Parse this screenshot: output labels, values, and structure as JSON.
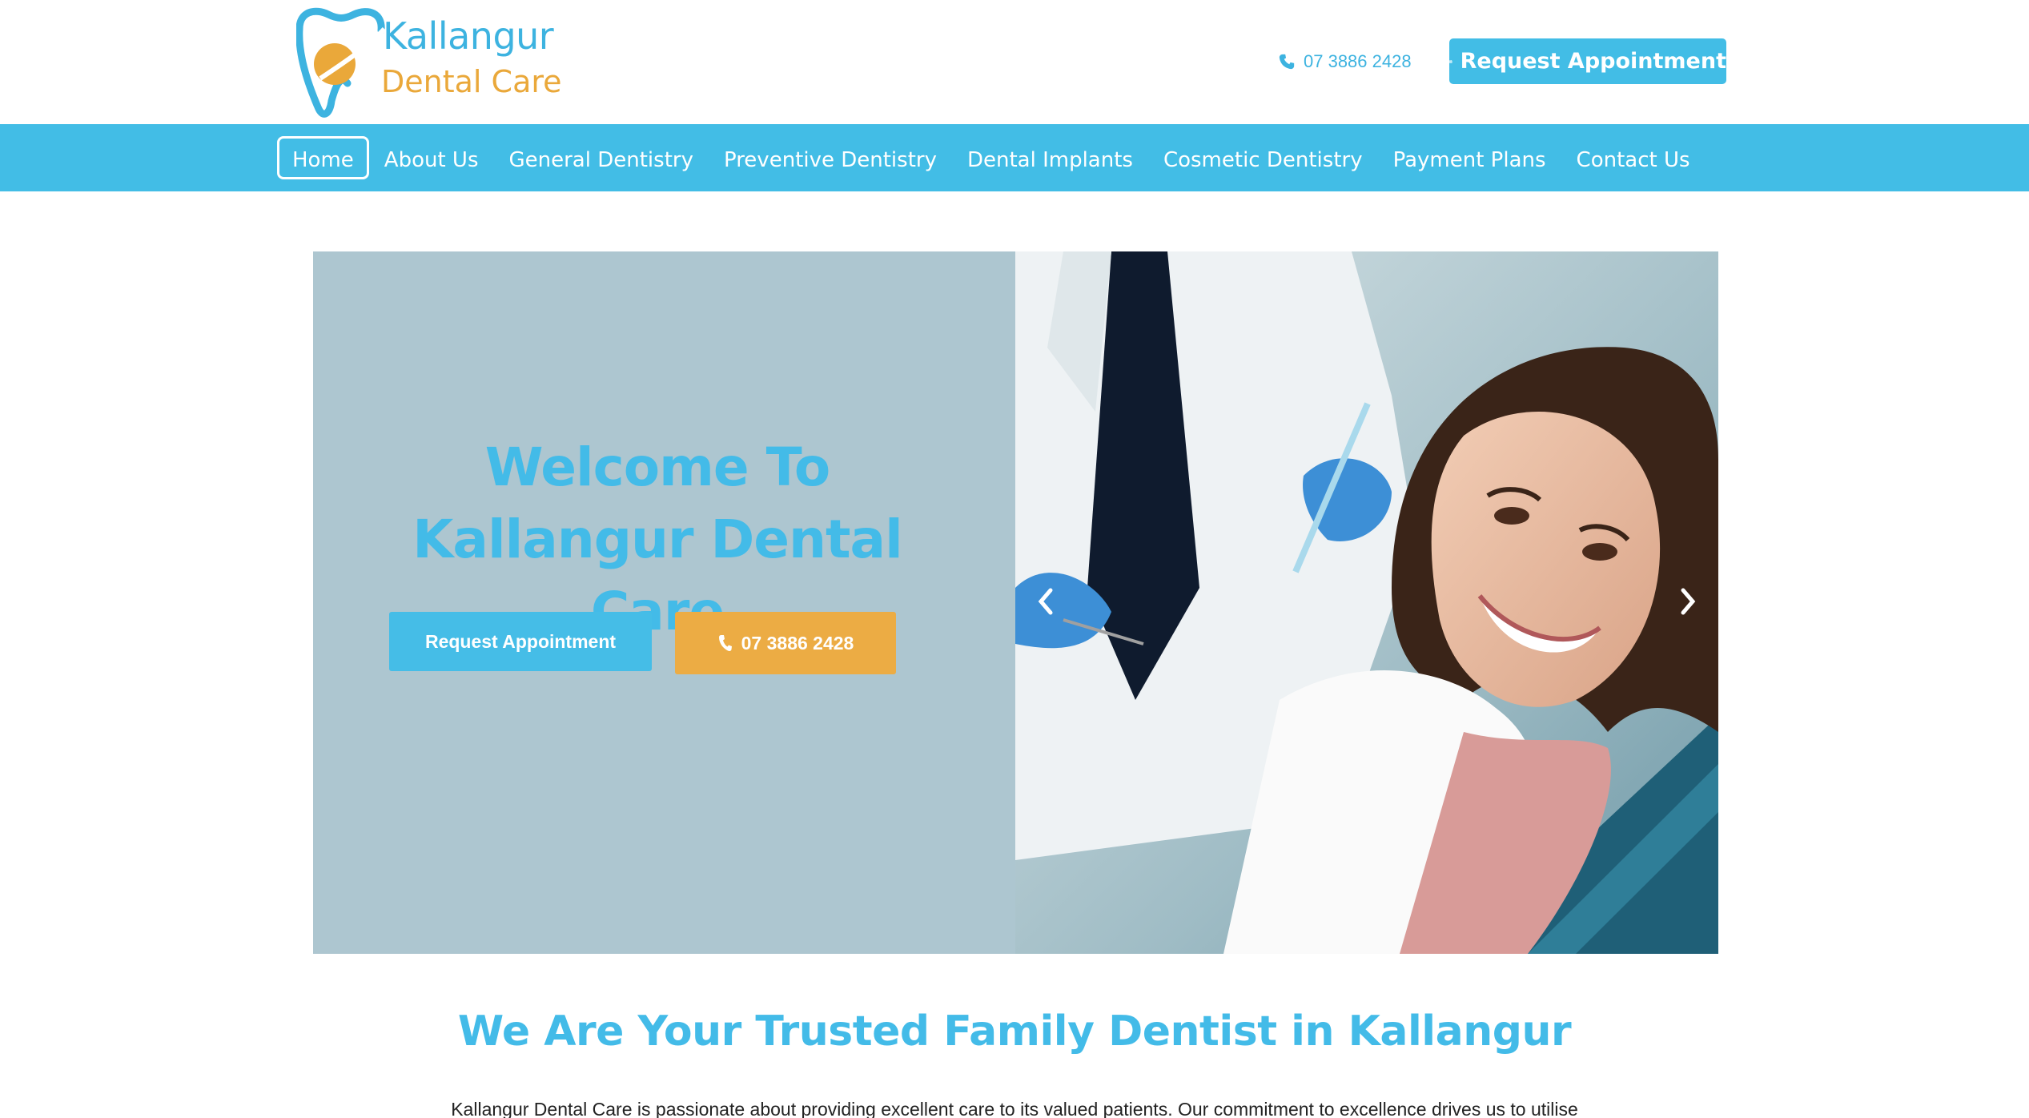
{
  "header": {
    "logo_line_1": "Kallangur",
    "logo_line_2": "Dental Care",
    "phone": "07 3886 2428",
    "cta_label": "Request Appointment"
  },
  "nav": {
    "items": [
      {
        "label": "Home",
        "active": true
      },
      {
        "label": "About Us"
      },
      {
        "label": "General Dentistry"
      },
      {
        "label": "Preventive Dentistry"
      },
      {
        "label": "Dental Implants"
      },
      {
        "label": "Cosmetic Dentistry"
      },
      {
        "label": "Payment Plans"
      },
      {
        "label": "Contact Us"
      }
    ]
  },
  "hero": {
    "title": "Welcome To Kallangur Dental Care",
    "button_appointment": "Request Appointment",
    "button_phone": "07 3886 2428",
    "image_icon": "dentist-patient-photo",
    "prev_icon": "chevron-left-icon",
    "next_icon": "chevron-right-icon"
  },
  "section": {
    "title": "We Are Your Trusted Family Dentist in Kallangur",
    "text": "Kallangur Dental Care is passionate about providing excellent care to its valued patients. Our commitment to excellence drives us to utilise"
  },
  "colors": {
    "brand_blue": "#42bde6",
    "brand_orange": "#ecac44",
    "hero_panel": "#adc6d0"
  }
}
